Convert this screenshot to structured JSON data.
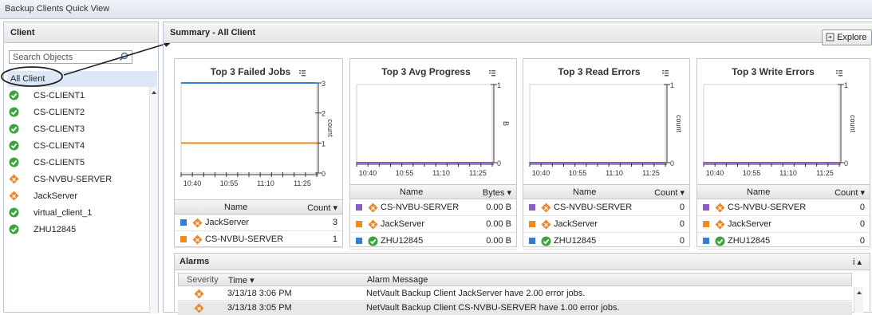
{
  "window": {
    "title": "Backup Clients Quick View"
  },
  "left": {
    "header": "Client",
    "search_placeholder": "Search Objects",
    "all_client": "All Client",
    "clients": [
      {
        "name": "CS-CLIENT1",
        "status": "ok"
      },
      {
        "name": "CS-CLIENT2",
        "status": "ok"
      },
      {
        "name": "CS-CLIENT3",
        "status": "ok"
      },
      {
        "name": "CS-CLIENT4",
        "status": "ok"
      },
      {
        "name": "CS-CLIENT5",
        "status": "ok"
      },
      {
        "name": "CS-NVBU-SERVER",
        "status": "warning"
      },
      {
        "name": "JackServer",
        "status": "warning"
      },
      {
        "name": "virtual_client_1",
        "status": "ok"
      },
      {
        "name": "ZHU12845",
        "status": "ok"
      }
    ]
  },
  "main": {
    "header": "Summary - All Client",
    "explore_label": "Explore"
  },
  "colors": {
    "ok": "#3aa53a",
    "warning": "#e8892b",
    "blue": "#2f7fd6",
    "orange": "#f08a1e",
    "purple": "#8e5cc8"
  },
  "cards": [
    {
      "title": "Top 3 Failed Jobs",
      "axis_label": "count",
      "col_name": "Name",
      "col_value": "Count ▾",
      "rows": [
        {
          "color": "blue",
          "status": "warning",
          "name": "JackServer",
          "value": "3"
        },
        {
          "color": "orange",
          "status": "warning",
          "name": "CS-NVBU-SERVER",
          "value": "1"
        }
      ]
    },
    {
      "title": "Top 3 Avg Progress",
      "axis_label": "B",
      "col_name": "Name",
      "col_value": "Bytes ▾",
      "rows": [
        {
          "color": "purple",
          "status": "warning",
          "name": "CS-NVBU-SERVER",
          "value": "0.00 B"
        },
        {
          "color": "orange",
          "status": "warning",
          "name": "JackServer",
          "value": "0.00 B"
        },
        {
          "color": "blue",
          "status": "ok",
          "name": "ZHU12845",
          "value": "0.00 B"
        }
      ]
    },
    {
      "title": "Top 3 Read Errors",
      "axis_label": "count",
      "col_name": "Name",
      "col_value": "Count ▾",
      "rows": [
        {
          "color": "purple",
          "status": "warning",
          "name": "CS-NVBU-SERVER",
          "value": "0"
        },
        {
          "color": "orange",
          "status": "warning",
          "name": "JackServer",
          "value": "0"
        },
        {
          "color": "blue",
          "status": "ok",
          "name": "ZHU12845",
          "value": "0"
        }
      ]
    },
    {
      "title": "Top 3 Write Errors",
      "axis_label": "count",
      "col_name": "Name",
      "col_value": "Count ▾",
      "rows": [
        {
          "color": "purple",
          "status": "warning",
          "name": "CS-NVBU-SERVER",
          "value": "0"
        },
        {
          "color": "orange",
          "status": "warning",
          "name": "JackServer",
          "value": "0"
        },
        {
          "color": "blue",
          "status": "ok",
          "name": "ZHU12845",
          "value": "0"
        }
      ]
    }
  ],
  "chart_data": [
    {
      "type": "line",
      "title": "Top 3 Failed Jobs",
      "ylabel": "count",
      "x_ticks": [
        "10:40",
        "10:55",
        "11:10",
        "11:25"
      ],
      "y_ticks": [
        "3",
        "2",
        "1",
        "0"
      ],
      "ylim": [
        0,
        3
      ],
      "series": [
        {
          "name": "JackServer",
          "color": "blue",
          "values": [
            3,
            3
          ]
        },
        {
          "name": "CS-NVBU-SERVER",
          "color": "orange",
          "values": [
            1,
            1
          ]
        }
      ]
    },
    {
      "type": "line",
      "title": "Top 3 Avg Progress",
      "ylabel": "B",
      "x_ticks": [
        "10:40",
        "10:55",
        "11:10",
        "11:25"
      ],
      "y_ticks": [
        "1",
        "0"
      ],
      "ylim": [
        0,
        1
      ],
      "series": [
        {
          "name": "CS-NVBU-SERVER",
          "color": "purple",
          "values": [
            0,
            0
          ]
        }
      ]
    },
    {
      "type": "line",
      "title": "Top 3 Read Errors",
      "ylabel": "count",
      "x_ticks": [
        "10:40",
        "10:55",
        "11:10",
        "11:25"
      ],
      "y_ticks": [
        "1",
        "0"
      ],
      "ylim": [
        0,
        1
      ],
      "series": [
        {
          "name": "CS-NVBU-SERVER",
          "color": "purple",
          "values": [
            0,
            0
          ]
        }
      ]
    },
    {
      "type": "line",
      "title": "Top 3 Write Errors",
      "ylabel": "count",
      "x_ticks": [
        "10:40",
        "10:55",
        "11:10",
        "11:25"
      ],
      "y_ticks": [
        "1",
        "0"
      ],
      "ylim": [
        0,
        1
      ],
      "series": [
        {
          "name": "CS-NVBU-SERVER",
          "color": "purple",
          "values": [
            0,
            0
          ]
        }
      ]
    }
  ],
  "alarms": {
    "header": "Alarms",
    "info_label": "i ▴",
    "col_severity": "Severity",
    "col_time": "Time ▾",
    "col_message": "Alarm Message",
    "rows": [
      {
        "severity": "warning",
        "time": "3/13/18 3:06 PM",
        "message": "NetVault Backup Client JackServer have 2.00 error jobs."
      },
      {
        "severity": "warning",
        "time": "3/13/18 3:05 PM",
        "message": "NetVault Backup Client CS-NVBU-SERVER have 1.00 error jobs."
      }
    ]
  }
}
